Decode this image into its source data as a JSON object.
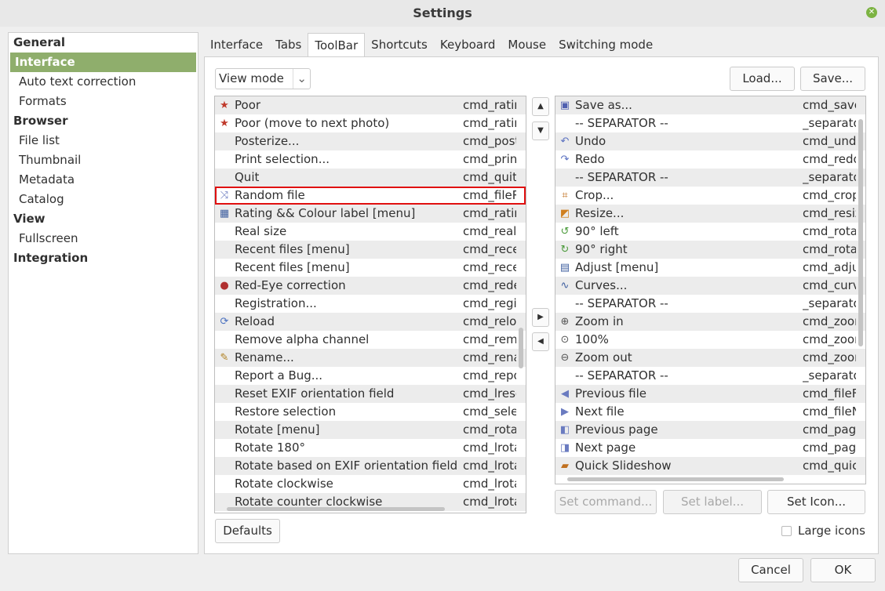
{
  "title": "Settings",
  "nav": [
    {
      "label": "General",
      "type": "h"
    },
    {
      "label": "Interface",
      "type": "h sel"
    },
    {
      "label": "Auto text correction",
      "type": "s"
    },
    {
      "label": "Formats",
      "type": "s"
    },
    {
      "label": "Browser",
      "type": "h"
    },
    {
      "label": "File list",
      "type": "s"
    },
    {
      "label": "Thumbnail",
      "type": "s"
    },
    {
      "label": "Metadata",
      "type": "s"
    },
    {
      "label": "Catalog",
      "type": "s"
    },
    {
      "label": "View",
      "type": "h"
    },
    {
      "label": "Fullscreen",
      "type": "s"
    },
    {
      "label": "Integration",
      "type": "h"
    }
  ],
  "tabs": [
    "Interface",
    "Tabs",
    "ToolBar",
    "Shortcuts",
    "Keyboard",
    "Mouse",
    "Switching mode"
  ],
  "active_tab": "ToolBar",
  "mode_select": "View mode",
  "load": "Load...",
  "save": "Save...",
  "available": [
    {
      "label": "Poor",
      "cmd": "cmd_ratin",
      "icon": "★",
      "color": "#c0392b"
    },
    {
      "label": "Poor (move to next photo)",
      "cmd": "cmd_ratin",
      "icon": "★",
      "color": "#c0392b"
    },
    {
      "label": "Posterize...",
      "cmd": "cmd_post"
    },
    {
      "label": "Print selection...",
      "cmd": "cmd_prin"
    },
    {
      "label": "Quit",
      "cmd": "cmd_quit"
    },
    {
      "label": "Random file",
      "cmd": "cmd_fileR",
      "icon": "⤨",
      "color": "#6a7bc0",
      "selected": true
    },
    {
      "label": "Rating && Colour label [menu]",
      "cmd": "cmd_ratin",
      "icon": "▦",
      "color": "#4060a0"
    },
    {
      "label": "Real size",
      "cmd": "cmd_real"
    },
    {
      "label": "Recent files [menu]",
      "cmd": "cmd_rece"
    },
    {
      "label": "Recent files [menu]",
      "cmd": "cmd_rece"
    },
    {
      "label": "Red-Eye correction",
      "cmd": "cmd_rede",
      "icon": "●",
      "color": "#b03030"
    },
    {
      "label": "Registration...",
      "cmd": "cmd_regi"
    },
    {
      "label": "Reload",
      "cmd": "cmd_relo",
      "icon": "⟳",
      "color": "#4a70c0"
    },
    {
      "label": "Remove alpha channel",
      "cmd": "cmd_rem"
    },
    {
      "label": "Rename...",
      "cmd": "cmd_rena",
      "icon": "✎",
      "color": "#b08020"
    },
    {
      "label": "Report a Bug...",
      "cmd": "cmd_repo"
    },
    {
      "label": "Reset EXIF orientation field",
      "cmd": "cmd_lrese"
    },
    {
      "label": "Restore selection",
      "cmd": "cmd_sele"
    },
    {
      "label": "Rotate [menu]",
      "cmd": "cmd_rota"
    },
    {
      "label": "Rotate 180°",
      "cmd": "cmd_lrota"
    },
    {
      "label": "Rotate based on EXIF orientation field",
      "cmd": "cmd_lrota"
    },
    {
      "label": "Rotate clockwise",
      "cmd": "cmd_lrota"
    },
    {
      "label": "Rotate counter clockwise",
      "cmd": "cmd_lrota"
    }
  ],
  "toolbar": [
    {
      "label": "Save as...",
      "cmd": "cmd_save",
      "icon": "▣",
      "color": "#5060b0"
    },
    {
      "label": "-- SEPARATOR --",
      "cmd": "_separato"
    },
    {
      "label": "Undo",
      "cmd": "cmd_und",
      "icon": "↶",
      "color": "#5a70c0"
    },
    {
      "label": "Redo",
      "cmd": "cmd_redo",
      "icon": "↷",
      "color": "#5a70c0"
    },
    {
      "label": "-- SEPARATOR --",
      "cmd": "_separato"
    },
    {
      "label": "Crop...",
      "cmd": "cmd_crop",
      "icon": "⌗",
      "color": "#c07020"
    },
    {
      "label": "Resize...",
      "cmd": "cmd_resiz",
      "icon": "◩",
      "color": "#d08020"
    },
    {
      "label": "90° left",
      "cmd": "cmd_rota",
      "icon": "↺",
      "color": "#4a9a3a"
    },
    {
      "label": "90° right",
      "cmd": "cmd_rota",
      "icon": "↻",
      "color": "#4a9a3a"
    },
    {
      "label": "Adjust [menu]",
      "cmd": "cmd_adju",
      "icon": "▤",
      "color": "#4060a0"
    },
    {
      "label": "Curves...",
      "cmd": "cmd_curv",
      "icon": "∿",
      "color": "#4060a0"
    },
    {
      "label": "-- SEPARATOR --",
      "cmd": "_separato"
    },
    {
      "label": "Zoom in",
      "cmd": "cmd_zoor",
      "icon": "⊕",
      "color": "#555"
    },
    {
      "label": "100%",
      "cmd": "cmd_zoor",
      "icon": "⊙",
      "color": "#555"
    },
    {
      "label": "Zoom out",
      "cmd": "cmd_zoor",
      "icon": "⊖",
      "color": "#555"
    },
    {
      "label": "-- SEPARATOR --",
      "cmd": "_separato"
    },
    {
      "label": "Previous file",
      "cmd": "cmd_fileF",
      "icon": "◀",
      "color": "#6a7bc0"
    },
    {
      "label": "Next file",
      "cmd": "cmd_fileN",
      "icon": "▶",
      "color": "#6a7bc0"
    },
    {
      "label": "Previous page",
      "cmd": "cmd_page",
      "icon": "◧",
      "color": "#6a7bc0"
    },
    {
      "label": "Next page",
      "cmd": "cmd_page",
      "icon": "◨",
      "color": "#6a7bc0"
    },
    {
      "label": "Quick Slideshow",
      "cmd": "cmd_quic",
      "icon": "▰",
      "color": "#c07020"
    }
  ],
  "set_command": "Set command...",
  "set_label": "Set label...",
  "set_icon": "Set Icon...",
  "defaults": "Defaults",
  "large_icons": "Large icons",
  "cancel": "Cancel",
  "ok": "OK"
}
